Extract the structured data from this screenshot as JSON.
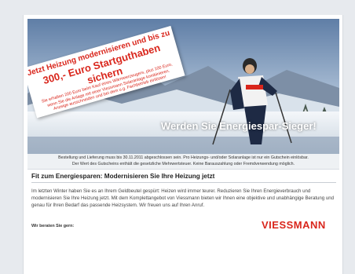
{
  "banner": {
    "promo": {
      "line1": "Jetzt Heizung modernisieren und bis zu",
      "line2": "300,- Euro Startguthaben sichern",
      "small1": "Sie erhalten 200 Euro beim Kauf eines Wärmeerzeugers, plus 100 Euro,",
      "small2": "wenn Sie die Anlage mit einer Viessmann Solaranlage kombinieren.",
      "small3": "Anzeige ausschneiden und bei dem u.g. Fachbetrieb einlösen!"
    },
    "tagline": "Werden Sie Energiespar-Sieger!"
  },
  "notice": {
    "line1": "Bestellung und Lieferung muss bis 30.11.2011 abgeschlossen sein. Pro Heizungs- und/oder Solaranlage ist nur ein Gutschein einlösbar.",
    "line2": "Der Wert des Gutscheins enthält die gesetzliche Mehrwertsteuer. Keine Barauszahlung oder Fremdverwendung möglich."
  },
  "article": {
    "title": "Fit zum Energiesparen: Modernisieren Sie Ihre Heizung jetzt",
    "body": "Im letzten Winter haben Sie es an Ihrem Geldbeutel gespürt: Heizen wird immer teurer. Reduzieren Sie Ihren Energieverbrauch und modernisieren Sie Ihre Heizung jetzt. Mit dem Komplettangebot von Viessmann bieten wir Ihnen eine objektive und unabhängige Beratung und genau für Ihren Bedarf das passende Heizsystem. Wir freuen uns auf Ihren Anruf.",
    "advice_label": "Wir beraten Sie gern:"
  },
  "logo": {
    "text": "VIESSMANN"
  },
  "colors": {
    "accent": "#d9261c",
    "page_bg": "#e7eaee",
    "sky": "#8ea8c4"
  }
}
